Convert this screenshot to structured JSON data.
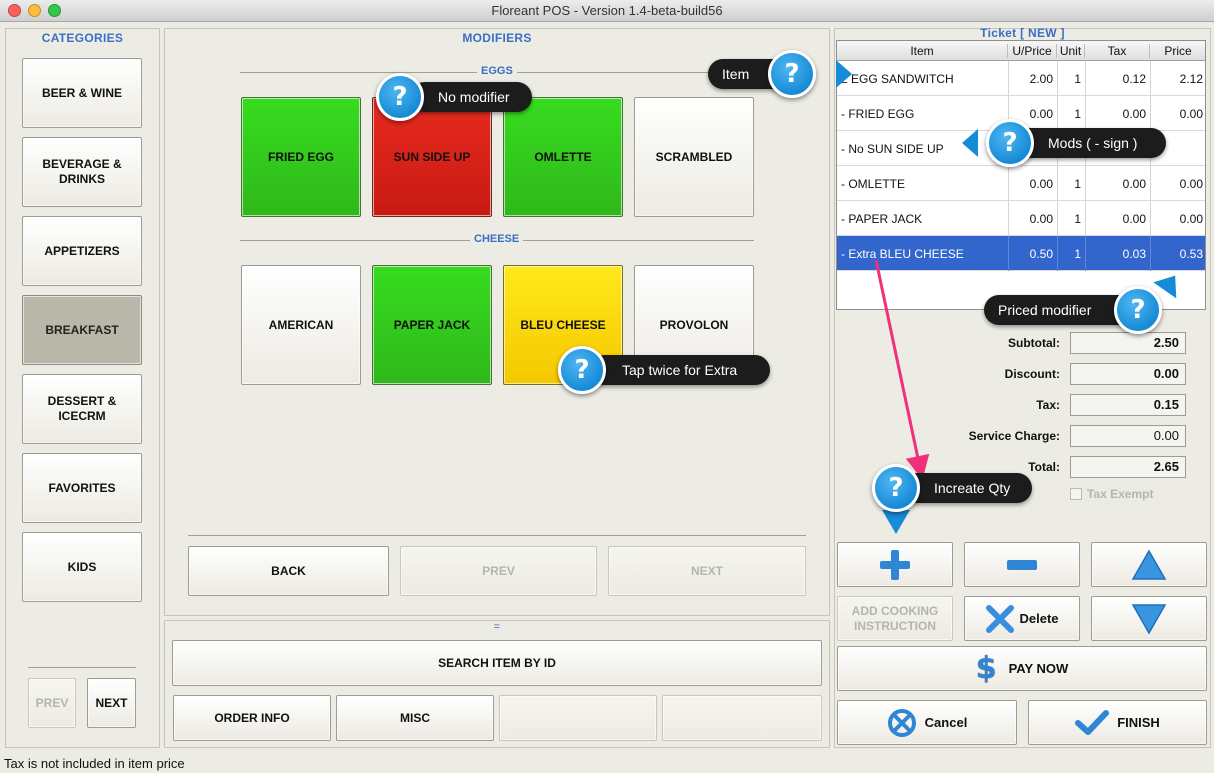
{
  "window": {
    "title": "Floreant POS - Version 1.4-beta-build56"
  },
  "categories": {
    "title": "CATEGORIES",
    "items": [
      {
        "label": "BEER & WINE"
      },
      {
        "label": "BEVERAGE & DRINKS"
      },
      {
        "label": "APPETIZERS"
      },
      {
        "label": "BREAKFAST"
      },
      {
        "label": "DESSERT & ICECRM"
      },
      {
        "label": "FAVORITES"
      },
      {
        "label": "KIDS"
      }
    ],
    "prev_label": "PREV",
    "next_label": "NEXT"
  },
  "modifiers": {
    "title": "MODIFIERS",
    "groups": [
      {
        "label": "EGGS",
        "items": [
          "FRIED EGG",
          "SUN SIDE UP",
          "OMLETTE",
          "SCRAMBLED"
        ]
      },
      {
        "label": "CHEESE",
        "items": [
          "AMERICAN",
          "PAPER JACK",
          "BLEU CHEESE",
          "PROVOLON"
        ]
      }
    ],
    "back_label": "BACK",
    "prev_label": "PREV",
    "next_label": "NEXT",
    "colors": {
      "selected": "#2fc21c",
      "no_modifier": "#d8221a",
      "extra": "#ffd80a"
    }
  },
  "bottom": {
    "divider": "=",
    "search_label": "SEARCH ITEM BY ID",
    "order_info_label": "ORDER INFO",
    "misc_label": "MISC"
  },
  "ticket": {
    "title": "Ticket [ NEW ]",
    "columns": [
      "Item",
      "U/Price",
      "Unit",
      "Tax",
      "Price"
    ],
    "rows": [
      {
        "item": "2 EGG SANDWITCH",
        "uprice": "2.00",
        "unit": "1",
        "tax": "0.12",
        "price": "2.12"
      },
      {
        "item": "- FRIED EGG",
        "uprice": "0.00",
        "unit": "1",
        "tax": "0.00",
        "price": "0.00"
      },
      {
        "item": "- No SUN SIDE UP",
        "uprice": "",
        "unit": "",
        "tax": "",
        "price": ""
      },
      {
        "item": "- OMLETTE",
        "uprice": "0.00",
        "unit": "1",
        "tax": "0.00",
        "price": "0.00"
      },
      {
        "item": "- PAPER JACK",
        "uprice": "0.00",
        "unit": "1",
        "tax": "0.00",
        "price": "0.00"
      },
      {
        "item": "- Extra BLEU CHEESE",
        "uprice": "0.50",
        "unit": "1",
        "tax": "0.03",
        "price": "0.53"
      }
    ],
    "selected_row_color": "#3366cc",
    "subtotal_label": "Subtotal:",
    "subtotal": "2.50",
    "discount_label": "Discount:",
    "discount": "0.00",
    "tax_label": "Tax:",
    "tax": "0.15",
    "service_label": "Service Charge:",
    "service": "0.00",
    "total_label": "Total:",
    "total": "2.65",
    "tax_exempt_label": "Tax Exempt"
  },
  "actions": {
    "add_cooking_label": "ADD COOKING INSTRUCTION",
    "delete_label": "Delete",
    "pay_now_label": "PAY NOW",
    "cancel_label": "Cancel",
    "finish_label": "FINISH"
  },
  "status": {
    "text": "Tax is not included in item price"
  },
  "callouts": {
    "item": "Item",
    "no_modifier": "No modifier",
    "mods": "Mods  ( - sign )",
    "priced_modifier": "Priced modifier",
    "tap_twice": "Tap twice for  Extra",
    "increase_qty": "Increate Qty",
    "badge_glyph": "?"
  }
}
